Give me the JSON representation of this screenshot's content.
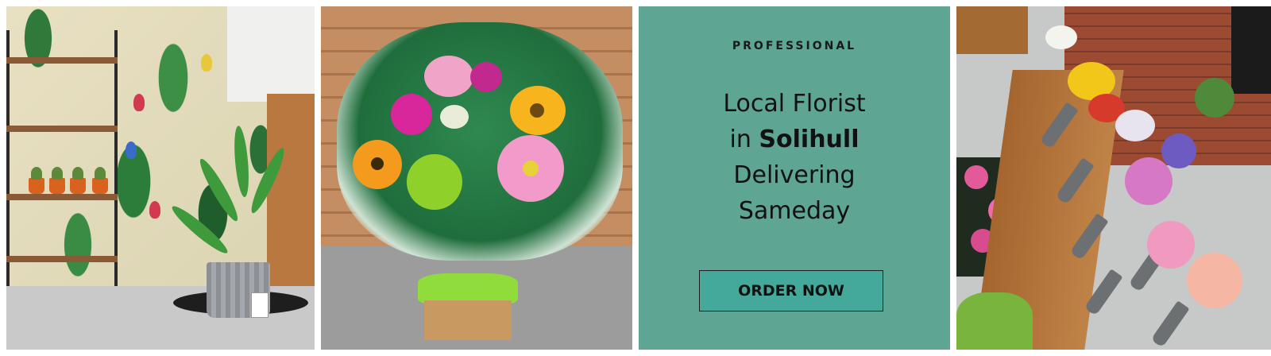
{
  "promo": {
    "eyebrow": "PROFESSIONAL",
    "headline_line1": "Local Florist",
    "headline_line2_prefix": "in ",
    "headline_line2_bold": "Solihull",
    "headline_line3": "Delivering",
    "headline_line4": "Sameday",
    "cta_label": "ORDER NOW"
  },
  "colors": {
    "panel_background": "#5ea593",
    "button_background": "#44a99a",
    "text": "#111111"
  }
}
